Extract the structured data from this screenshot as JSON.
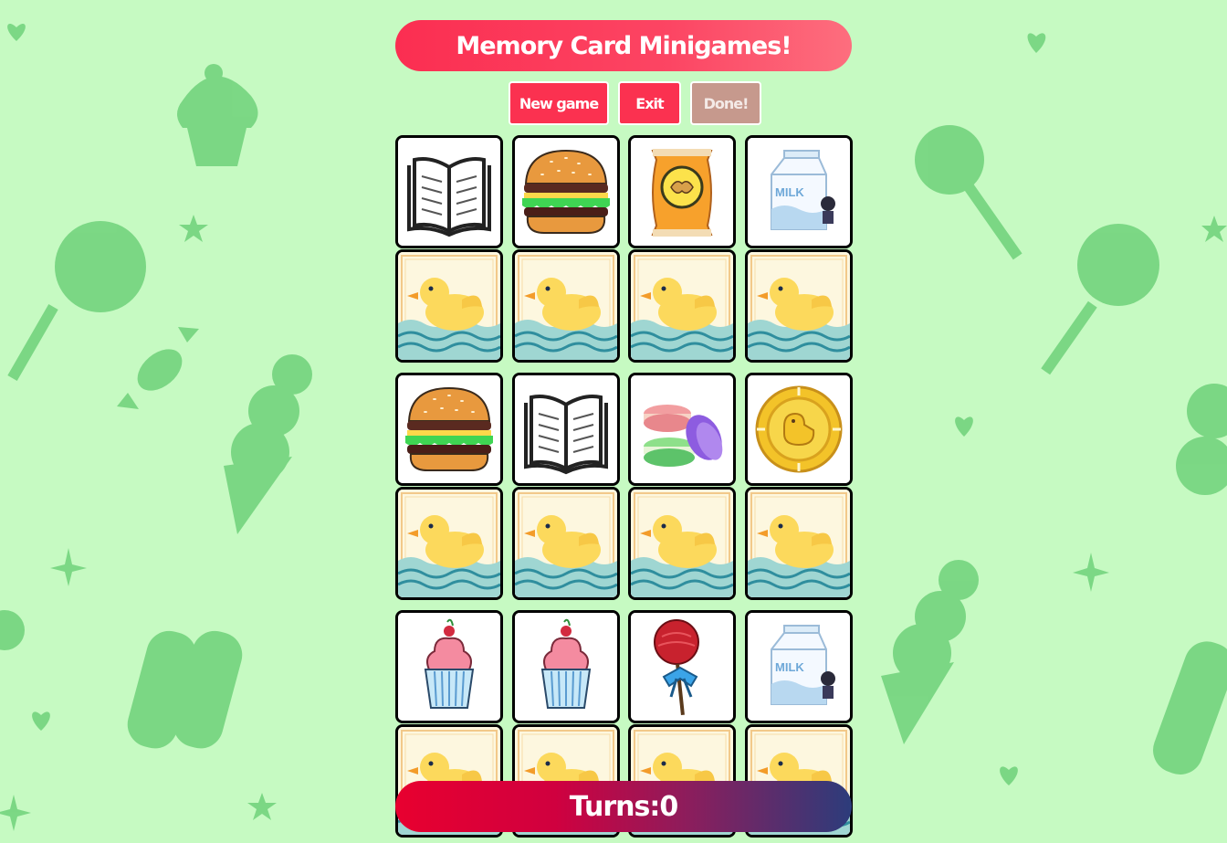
{
  "game": {
    "title": "Memory Card Minigames!",
    "buttons": {
      "new_game": "New game",
      "exit": "Exit",
      "done": "Done!"
    },
    "turns_label": "Turns:",
    "turns": "0",
    "turns_text": "Turns:0"
  },
  "colors": {
    "background": "#c6fac2",
    "background_shapes": "#6fd17a",
    "title_bar": "#fb2e51",
    "button": "#fb3150",
    "done_button": "#c6998d",
    "turns_gradient_start": "#e8002f",
    "turns_gradient_end": "#2c3c7b"
  },
  "board": {
    "rows": [
      [
        "book-icon",
        "burger-icon",
        "chips-icon",
        "milk-icon"
      ],
      [
        "duck-card-back",
        "duck-card-back",
        "duck-card-back",
        "duck-card-back"
      ],
      [
        "burger-icon",
        "book-icon",
        "macarons-icon",
        "duck-coin-icon"
      ],
      [
        "duck-card-back",
        "duck-card-back",
        "duck-card-back",
        "duck-card-back"
      ],
      [
        "cupcake-icon",
        "cupcake-icon",
        "lollipop-icon",
        "milk-icon"
      ],
      [
        "duck-card-back",
        "duck-card-back",
        "duck-card-back",
        "duck-card-back"
      ]
    ],
    "milk_label": "MILK"
  },
  "background_icons": [
    "cupcake-icon",
    "lollipop-icon",
    "candy-icon",
    "ice-cream-icon",
    "popsicle-icon",
    "heart-icon",
    "star-icon",
    "sparkle-icon"
  ]
}
